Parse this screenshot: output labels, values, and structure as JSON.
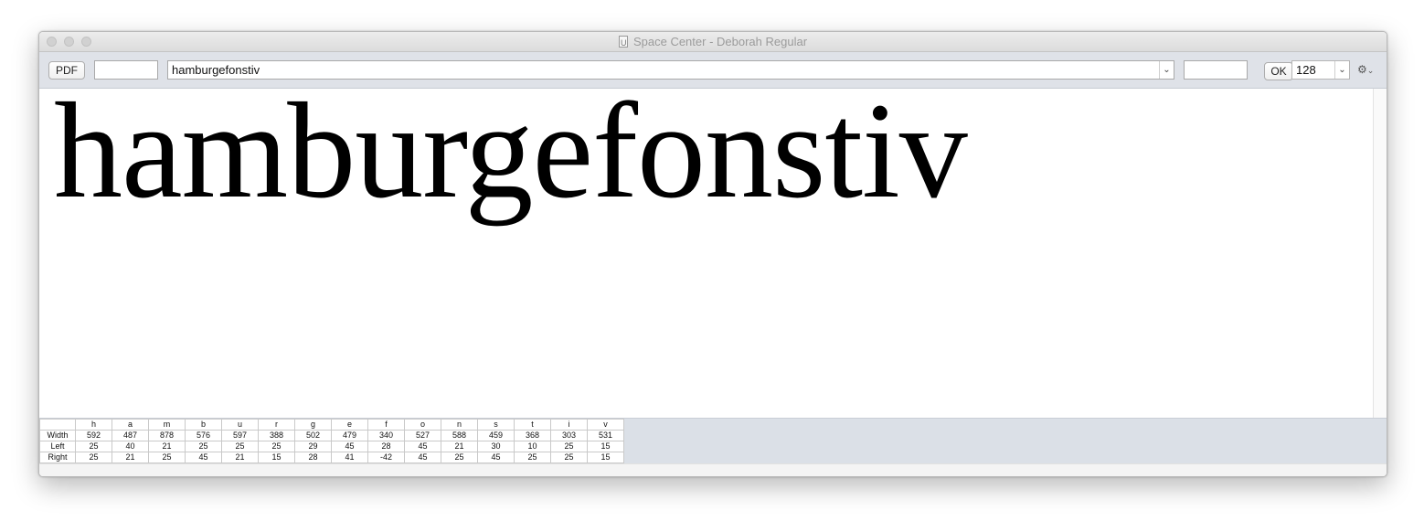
{
  "window": {
    "title": "Space Center - Deborah Regular"
  },
  "toolbar": {
    "pdf_label": "PDF",
    "left_field_value": "",
    "text_value": "hamburgefonstiv",
    "right_field_value": "",
    "ok_label": "OK",
    "size_value": "128",
    "settings_icon": "gear-icon"
  },
  "preview": {
    "text": "hamburgefonstiv"
  },
  "metrics": {
    "rows": [
      "Width",
      "Left",
      "Right"
    ],
    "glyphs": [
      {
        "name": "h",
        "width": "592",
        "left": "25",
        "right": "25"
      },
      {
        "name": "a",
        "width": "487",
        "left": "40",
        "right": "21"
      },
      {
        "name": "m",
        "width": "878",
        "left": "21",
        "right": "25"
      },
      {
        "name": "b",
        "width": "576",
        "left": "25",
        "right": "45"
      },
      {
        "name": "u",
        "width": "597",
        "left": "25",
        "right": "21"
      },
      {
        "name": "r",
        "width": "388",
        "left": "25",
        "right": "15"
      },
      {
        "name": "g",
        "width": "502",
        "left": "29",
        "right": "28"
      },
      {
        "name": "e",
        "width": "479",
        "left": "45",
        "right": "41"
      },
      {
        "name": "f",
        "width": "340",
        "left": "28",
        "right": "-42"
      },
      {
        "name": "o",
        "width": "527",
        "left": "45",
        "right": "45"
      },
      {
        "name": "n",
        "width": "588",
        "left": "21",
        "right": "25"
      },
      {
        "name": "s",
        "width": "459",
        "left": "30",
        "right": "45"
      },
      {
        "name": "t",
        "width": "368",
        "left": "10",
        "right": "25"
      },
      {
        "name": "i",
        "width": "303",
        "left": "25",
        "right": "25"
      },
      {
        "name": "v",
        "width": "531",
        "left": "15",
        "right": "15"
      }
    ]
  }
}
